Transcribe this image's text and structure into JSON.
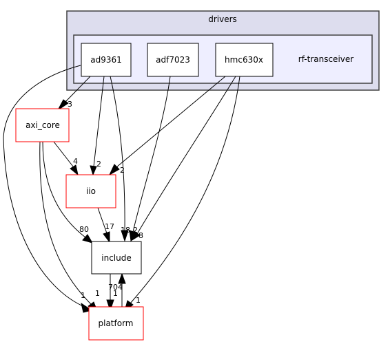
{
  "graph": {
    "type": "directory-dependency-graph",
    "clusters": [
      {
        "id": "drivers",
        "label": "drivers",
        "fill": "#ddddee",
        "border": "#404040"
      },
      {
        "id": "rf-transceiver",
        "label": "rf-transceiver",
        "fill": "#eeeeff",
        "border": "#404040"
      }
    ],
    "nodes": [
      {
        "id": "ad9361",
        "label": "ad9361",
        "border": "#000000"
      },
      {
        "id": "adf7023",
        "label": "adf7023",
        "border": "#000000"
      },
      {
        "id": "hmc630x",
        "label": "hmc630x",
        "border": "#000000"
      },
      {
        "id": "axi_core",
        "label": "axi_core",
        "border": "#ff0000"
      },
      {
        "id": "iio",
        "label": "iio",
        "border": "#ff0000"
      },
      {
        "id": "include",
        "label": "include",
        "border": "#000000"
      },
      {
        "id": "platform",
        "label": "platform",
        "border": "#ff0000"
      }
    ],
    "edges": [
      {
        "from": "ad9361",
        "to": "axi_core",
        "label": "3"
      },
      {
        "from": "ad9361",
        "to": "iio",
        "label": "2"
      },
      {
        "from": "ad9361",
        "to": "include",
        "label": "18"
      },
      {
        "from": "ad9361",
        "to": "platform",
        "label": "1"
      },
      {
        "from": "adf7023",
        "to": "include",
        "label": "2"
      },
      {
        "from": "hmc630x",
        "to": "iio",
        "label": "2"
      },
      {
        "from": "hmc630x",
        "to": "include",
        "label": "8"
      },
      {
        "from": "hmc630x",
        "to": "platform",
        "label": "1"
      },
      {
        "from": "axi_core",
        "to": "iio",
        "label": "4"
      },
      {
        "from": "axi_core",
        "to": "include",
        "label": "80"
      },
      {
        "from": "axi_core",
        "to": "platform",
        "label": "1"
      },
      {
        "from": "iio",
        "to": "include",
        "label": "17"
      },
      {
        "from": "include",
        "to": "platform",
        "label": "1"
      },
      {
        "from": "platform",
        "to": "include",
        "label": "704"
      }
    ]
  }
}
